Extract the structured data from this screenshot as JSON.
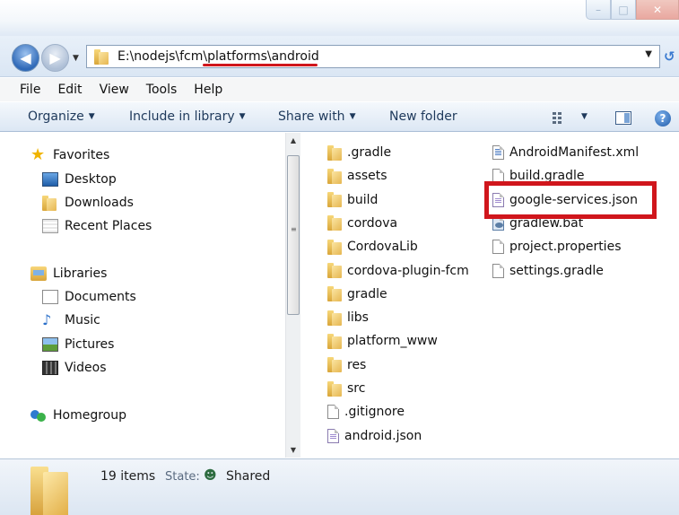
{
  "window": {
    "minimize_icon": "minimize-icon",
    "maximize_icon": "maximize-icon",
    "close_icon": "close-icon"
  },
  "address": {
    "path": "E:\\nodejs\\fcm\\platforms\\android"
  },
  "menu": [
    "File",
    "Edit",
    "View",
    "Tools",
    "Help"
  ],
  "toolbar": {
    "organize": "Organize",
    "include_in_library": "Include in library",
    "share_with": "Share with",
    "new_folder": "New folder"
  },
  "nav": {
    "favorites": "Favorites",
    "desktop": "Desktop",
    "downloads": "Downloads",
    "recent_places": "Recent Places",
    "libraries": "Libraries",
    "documents": "Documents",
    "music": "Music",
    "pictures": "Pictures",
    "videos": "Videos",
    "homegroup": "Homegroup"
  },
  "files": {
    "col1": [
      ".gradle",
      "assets",
      "build",
      "cordova",
      "CordovaLib",
      "cordova-plugin-fcm",
      "gradle",
      "libs",
      "platform_www",
      "res",
      "src",
      ".gitignore",
      "android.json"
    ],
    "col2": [
      "AndroidManifest.xml",
      "build.gradle",
      "google-services.json",
      "gradlew.bat",
      "project.properties",
      "settings.gradle"
    ]
  },
  "status": {
    "count": "19 items",
    "state_label": "State:",
    "state_value": "Shared"
  },
  "colors": {
    "highlight": "#d0161c",
    "accent": "#1e395b"
  }
}
